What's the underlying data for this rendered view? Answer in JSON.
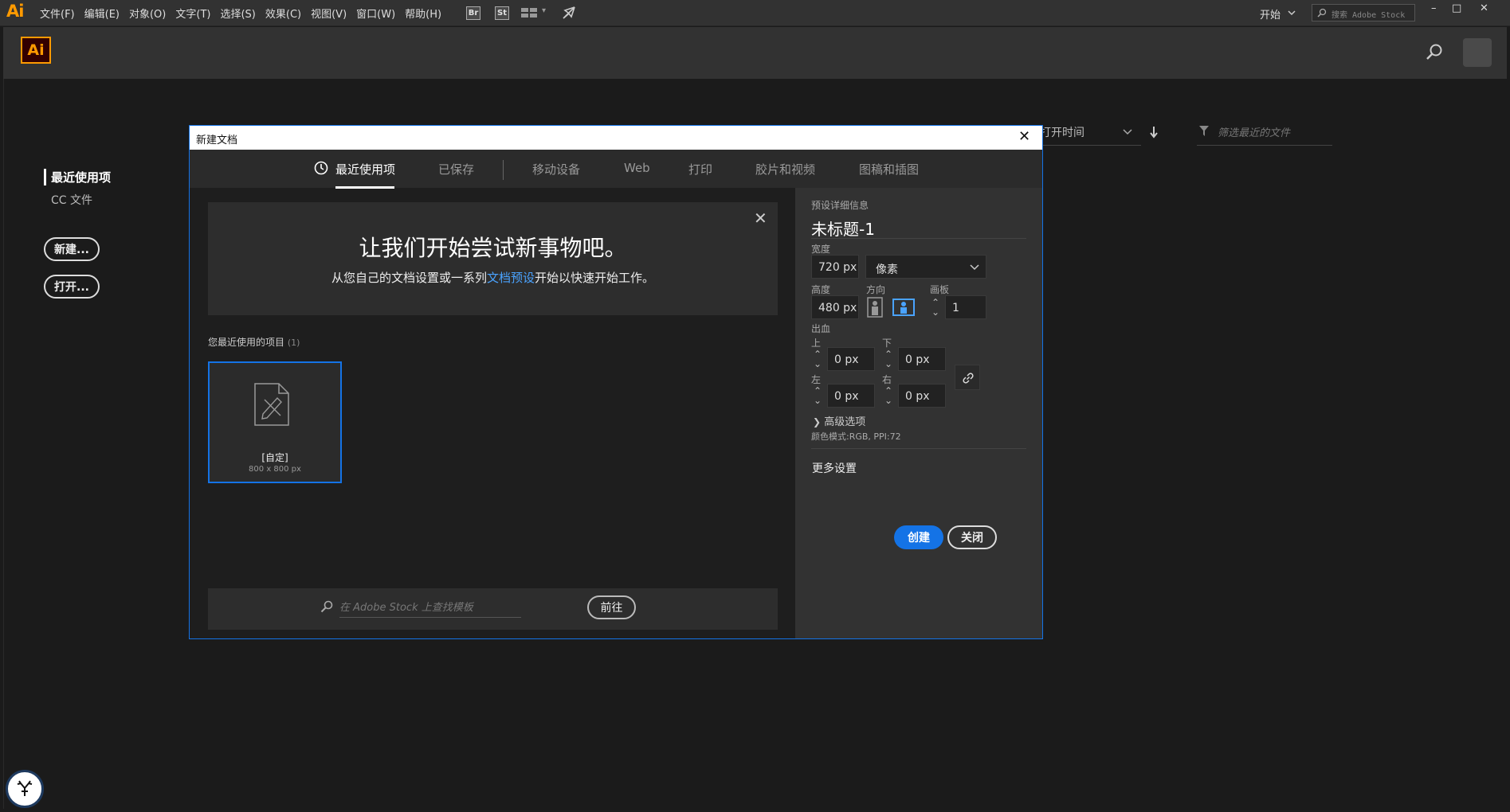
{
  "app": {
    "logo_text": "Ai"
  },
  "menus": [
    "文件(F)",
    "编辑(E)",
    "对象(O)",
    "文字(T)",
    "选择(S)",
    "效果(C)",
    "视图(V)",
    "窗口(W)",
    "帮助(H)"
  ],
  "bridge_buttons": {
    "br": "Br",
    "st": "St"
  },
  "workspace": {
    "label": "开始"
  },
  "stock_search": {
    "placeholder": "搜索 Adobe Stock"
  },
  "window_controls": {
    "minimize": "–",
    "maximize": "□",
    "close": "✕"
  },
  "home": {
    "logo": "Ai",
    "nav": {
      "recent": "最近使用项",
      "cc_files": "CC 文件"
    },
    "new_button": "新建...",
    "open_button": "打开...",
    "sort_label": "打开时间",
    "filter_placeholder": "筛选最近的文件"
  },
  "dialog": {
    "title": "新建文档",
    "close": "✕",
    "tabs": [
      "最近使用项",
      "已保存",
      "移动设备",
      "Web",
      "打印",
      "胶片和视频",
      "图稿和插图"
    ],
    "banner": {
      "title": "让我们开始尝试新事物吧。",
      "sub_before": "从您自己的文档设置或一系列",
      "sub_link": "文档预设",
      "sub_after": "开始以快速开始工作。",
      "close": "✕"
    },
    "recent": {
      "label": "您最近使用的项目",
      "count": "(1)"
    },
    "preset": {
      "name": "[自定]",
      "size": "800 x 800 px"
    },
    "stock": {
      "placeholder": "在 Adobe Stock 上查找模板",
      "go": "前往"
    },
    "details": {
      "header": "预设详细信息",
      "doc_name": "未标题-1",
      "width_label": "宽度",
      "width_value": "720 px",
      "unit": "像素",
      "height_label": "高度",
      "height_value": "480 px",
      "orientation_label": "方向",
      "artboards_label": "画板",
      "artboards_value": "1",
      "bleed_label": "出血",
      "top_label": "上",
      "top_value": "0 px",
      "bottom_label": "下",
      "bottom_value": "0 px",
      "left_label": "左",
      "left_value": "0 px",
      "right_label": "右",
      "right_value": "0 px",
      "advanced": "高级选项",
      "color_mode": "颜色模式:RGB, PPI:72",
      "more_settings": "更多设置",
      "create": "创建",
      "close": "关闭"
    }
  },
  "colors": {
    "accent": "#1473e6",
    "ai_orange": "#ff9a00"
  }
}
